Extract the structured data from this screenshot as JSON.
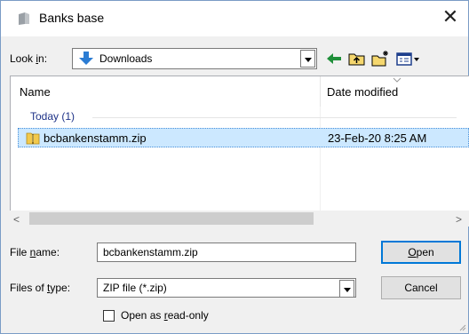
{
  "window": {
    "title": "Banks base"
  },
  "lookin": {
    "label_pre": "Look ",
    "label_u": "i",
    "label_post": "n:",
    "value": "Downloads"
  },
  "list": {
    "headers": {
      "name": "Name",
      "date": "Date modified"
    },
    "group": "Today (1)",
    "rows": [
      {
        "name": "bcbankenstamm.zip",
        "date": "23-Feb-20 8:25 AM"
      }
    ]
  },
  "filename": {
    "label_pre": "File ",
    "label_u": "n",
    "label_post": "ame:",
    "value": "bcbankenstamm.zip"
  },
  "filetype": {
    "label_pre": "Files of ",
    "label_u": "t",
    "label_post": "ype:",
    "value": "ZIP file (*.zip)"
  },
  "buttons": {
    "open_u": "O",
    "open_rest": "pen",
    "cancel": "Cancel"
  },
  "readonly": {
    "label_pre": "Open as ",
    "label_u": "r",
    "label_post": "ead-only"
  },
  "colors": {
    "selection": "#cce8ff",
    "accent": "#0078d7",
    "group": "#1e3287"
  },
  "icons": [
    "app-icon",
    "downloads-icon",
    "back-icon",
    "up-folder-icon",
    "new-folder-icon",
    "view-menu-icon",
    "zip-icon",
    "close-icon"
  ]
}
